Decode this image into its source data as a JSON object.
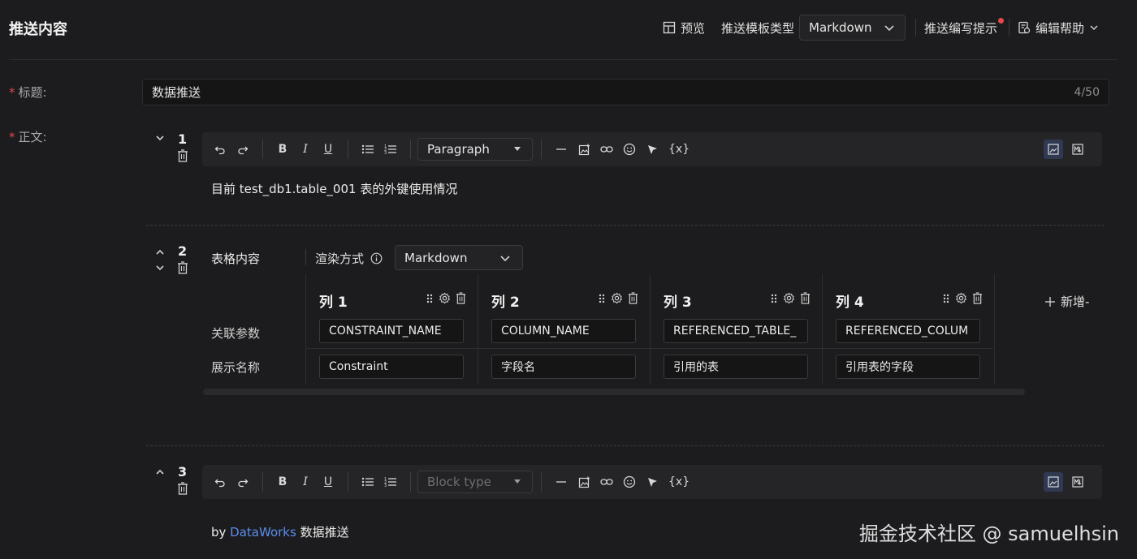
{
  "header": {
    "title": "推送内容",
    "preview_label": "预览",
    "template_type_label": "推送模板类型",
    "template_type_value": "Markdown",
    "writing_tips_label": "推送编写提示",
    "edit_help_label": "编辑帮助",
    "notification_dot_color": "#e5484d"
  },
  "form": {
    "title_label": "标题:",
    "title_value": "数据推送",
    "title_count": "4/50",
    "body_label": "正文:"
  },
  "blocks": {
    "b1": {
      "number": "1",
      "block_type": "Paragraph",
      "content": "目前 test_db1.table_001 表的外键使用情况"
    },
    "b2": {
      "number": "2",
      "section_label": "表格内容",
      "render_label": "渲染方式",
      "render_value": "Markdown",
      "add_label": "新增-",
      "row_labels": [
        "关联参数",
        "展示名称"
      ],
      "columns": [
        {
          "header": "列 1",
          "param": "CONSTRAINT_NAME",
          "display": "Constraint"
        },
        {
          "header": "列 2",
          "param": "COLUMN_NAME",
          "display": "字段名"
        },
        {
          "header": "列 3",
          "param": "REFERENCED_TABLE_",
          "display": "引用的表"
        },
        {
          "header": "列 4",
          "param": "REFERENCED_COLUM",
          "display": "引用表的字段"
        }
      ]
    },
    "b3": {
      "number": "3",
      "block_type_placeholder": "Block type",
      "content_prefix": "by ",
      "content_link": "DataWorks",
      "content_suffix": " 数据推送"
    }
  },
  "toolbar": {
    "var_label": "{x}",
    "bold": "B",
    "italic": "I",
    "underline": "U"
  },
  "watermark": "掘金技术社区 @ samuelhsin",
  "colors": {
    "background": "#1c1c1e",
    "link": "#5b8def",
    "required_star": "#e5484d"
  }
}
